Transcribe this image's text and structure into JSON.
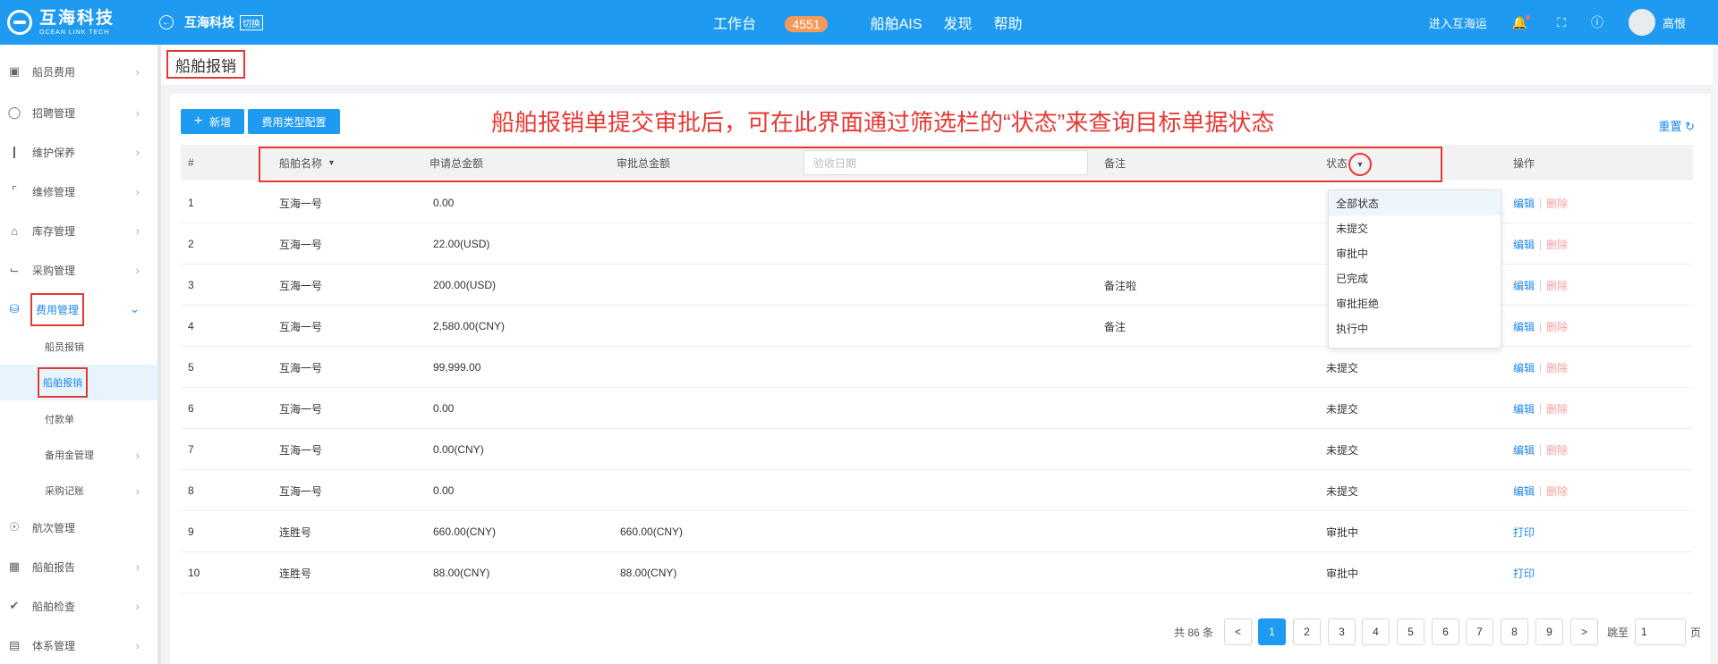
{
  "topbar": {
    "logo_cn": "互海科技",
    "logo_en": "OCEAN LINK TECH",
    "company": "互海科技",
    "switch_label": "切换",
    "nav": [
      "工作台",
      "船舶AIS",
      "发现",
      "帮助"
    ],
    "workbench_badge": "4551",
    "enter_label": "进入互海运",
    "user_name": "高恨"
  },
  "sidebar": {
    "items": [
      {
        "label": "船员费用",
        "icon": "wallet-icon"
      },
      {
        "label": "招聘管理",
        "icon": "user-icon"
      },
      {
        "label": "维护保养",
        "icon": "tool-icon"
      },
      {
        "label": "维修管理",
        "icon": "wrench-icon"
      },
      {
        "label": "库存管理",
        "icon": "home-icon"
      },
      {
        "label": "采购管理",
        "icon": "cart-icon"
      },
      {
        "label": "费用管理",
        "icon": "database-icon"
      },
      {
        "label": "航次管理",
        "icon": "globe-icon"
      },
      {
        "label": "船舶报告",
        "icon": "calendar-icon"
      },
      {
        "label": "船舶检查",
        "icon": "check-circle-icon"
      },
      {
        "label": "体系管理",
        "icon": "document-icon"
      }
    ],
    "sub_items": [
      "船员报销",
      "船舶报销",
      "付款单",
      "备用金管理",
      "采购记账"
    ]
  },
  "page": {
    "title": "船舶报销",
    "add_button": "新增",
    "config_button": "费用类型配置",
    "annotation": "船舶报销单提交审批后，可在此界面通过筛选栏的“状态”来查询目标单据状态",
    "reset": "重置"
  },
  "table": {
    "headers": {
      "index": "#",
      "ship": "船舶名称",
      "apply_total": "申请总金额",
      "approve_total": "审批总金额",
      "date_placeholder": "验收日期",
      "remark": "备注",
      "status": "状态",
      "ops": "操作"
    },
    "rows": [
      {
        "no": "1",
        "ship": "互海一号",
        "apply": "0.00",
        "approve": "",
        "remark": "",
        "status": "",
        "ops": [
          "编辑",
          "删除"
        ]
      },
      {
        "no": "2",
        "ship": "互海一号",
        "apply": "22.00(USD)",
        "approve": "",
        "remark": "",
        "status": "",
        "ops": [
          "编辑",
          "删除"
        ]
      },
      {
        "no": "3",
        "ship": "互海一号",
        "apply": "200.00(USD)",
        "approve": "",
        "remark": "备注啦",
        "status": "",
        "ops": [
          "编辑",
          "删除"
        ]
      },
      {
        "no": "4",
        "ship": "互海一号",
        "apply": "2,580.00(CNY)",
        "approve": "",
        "remark": "备注",
        "status": "",
        "ops": [
          "编辑",
          "删除"
        ]
      },
      {
        "no": "5",
        "ship": "互海一号",
        "apply": "99,999.00",
        "approve": "",
        "remark": "",
        "status": "未提交",
        "ops": [
          "编辑",
          "删除"
        ]
      },
      {
        "no": "6",
        "ship": "互海一号",
        "apply": "0.00",
        "approve": "",
        "remark": "",
        "status": "未提交",
        "ops": [
          "编辑",
          "删除"
        ]
      },
      {
        "no": "7",
        "ship": "互海一号",
        "apply": "0.00(CNY)",
        "approve": "",
        "remark": "",
        "status": "未提交",
        "ops": [
          "编辑",
          "删除"
        ]
      },
      {
        "no": "8",
        "ship": "互海一号",
        "apply": "0.00",
        "approve": "",
        "remark": "",
        "status": "未提交",
        "ops": [
          "编辑",
          "删除"
        ]
      },
      {
        "no": "9",
        "ship": "连胜号",
        "apply": "660.00(CNY)",
        "approve": "660.00(CNY)",
        "remark": "",
        "status": "审批中",
        "ops": [
          "打印"
        ]
      },
      {
        "no": "10",
        "ship": "连胜号",
        "apply": "88.00(CNY)",
        "approve": "88.00(CNY)",
        "remark": "",
        "status": "审批中",
        "ops": [
          "打印"
        ]
      }
    ]
  },
  "status_dropdown": [
    "全部状态",
    "未提交",
    "审批中",
    "已完成",
    "审批拒绝",
    "执行中"
  ],
  "pagination": {
    "total_text": "共 86 条",
    "pages": [
      "1",
      "2",
      "3",
      "4",
      "5",
      "6",
      "7",
      "8",
      "9"
    ],
    "prev": "<",
    "next": ">",
    "jump_label": "跳至",
    "jump_value": "1",
    "page_suffix": "页"
  }
}
